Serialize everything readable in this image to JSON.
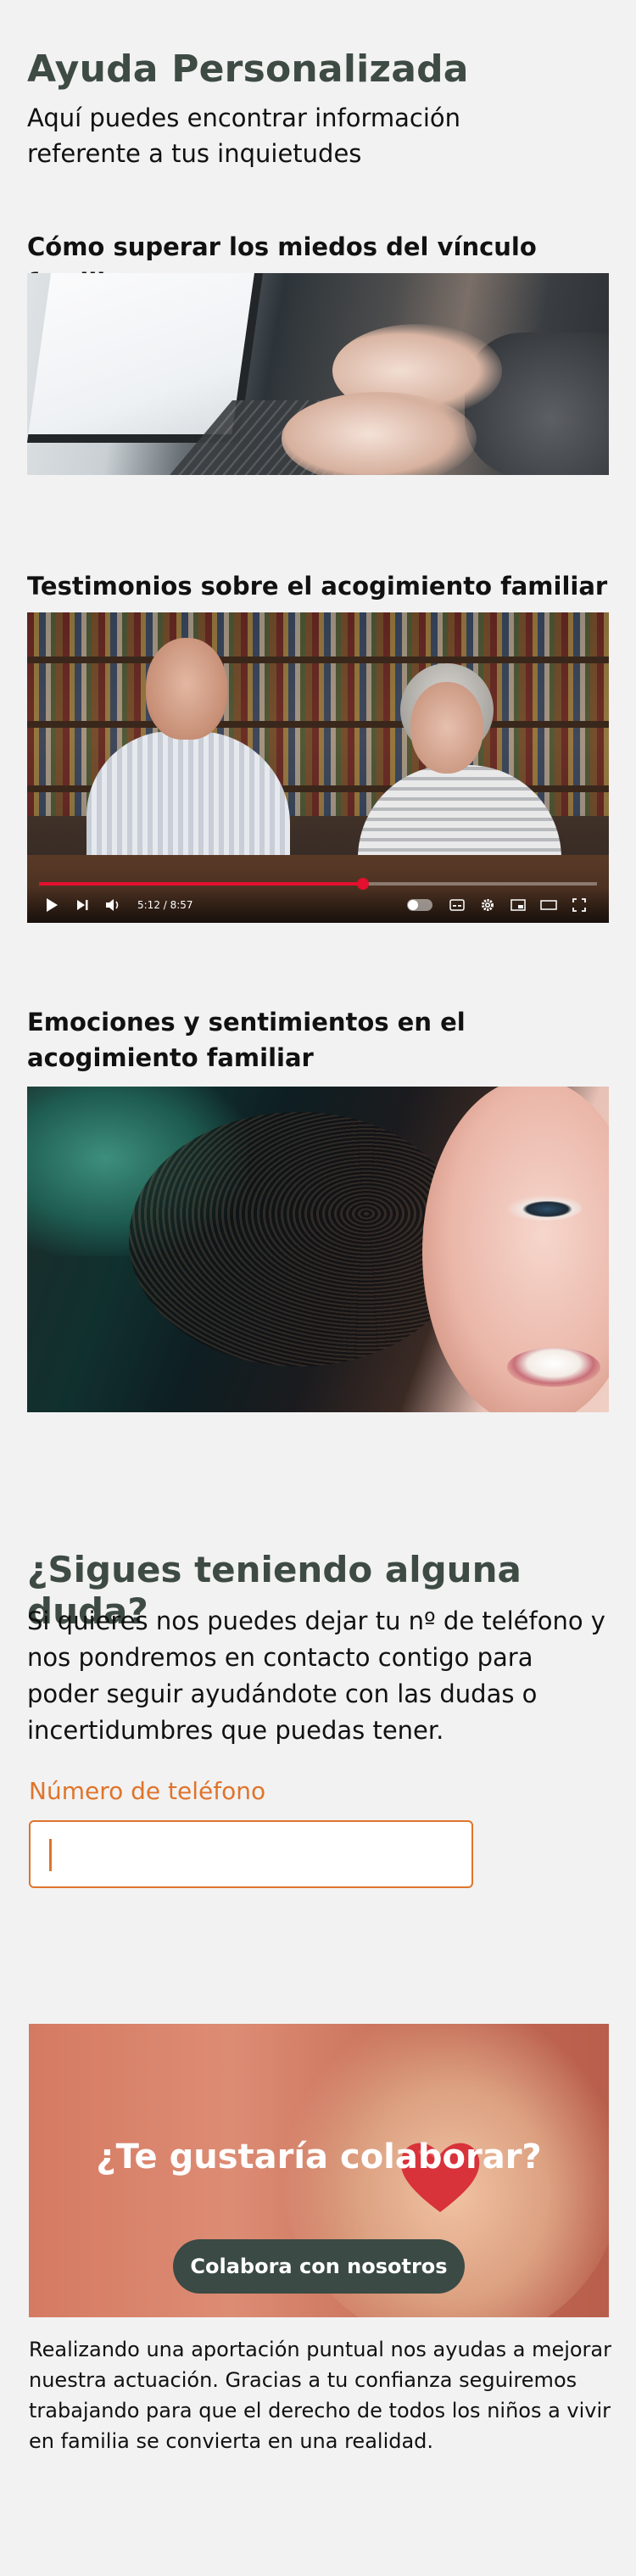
{
  "header": {
    "title": "Ayuda Personalizada",
    "subtitle": "Aquí puedes encontrar información referente a tus inquietudes"
  },
  "sections": [
    {
      "title": "Cómo superar los miedos del vínculo familiar"
    },
    {
      "title": "Testimonios sobre el acogimiento familiar"
    },
    {
      "title": "Emociones y sentimientos en el acogimiento familiar"
    }
  ],
  "video": {
    "time": "5:12 / 8:57",
    "progress": 0.58
  },
  "question": {
    "title": "¿Sigues teniendo alguna duda?",
    "text": "Si quieres nos puedes dejar tu nº de teléfono y nos pondremos en contacto contigo para poder seguir ayudándote con las dudas o incertidumbres que puedas tener.",
    "phone_label": "Número de teléfono",
    "phone_value": ""
  },
  "collaborate": {
    "title": "¿Te gustaría colaborar?",
    "button": "Colabora con nosotros",
    "description": "Realizando una aportación puntual nos ayudas a mejorar nuestra actuación. Gracias a tu confianza seguiremos trabajando para que el derecho de todos los niños a vivir en familia se convierta en una realidad."
  },
  "colors": {
    "heading": "#3e4b44",
    "accent": "#e0742c",
    "button_bg": "#3b4a44",
    "video_progress": "#e4102f"
  }
}
